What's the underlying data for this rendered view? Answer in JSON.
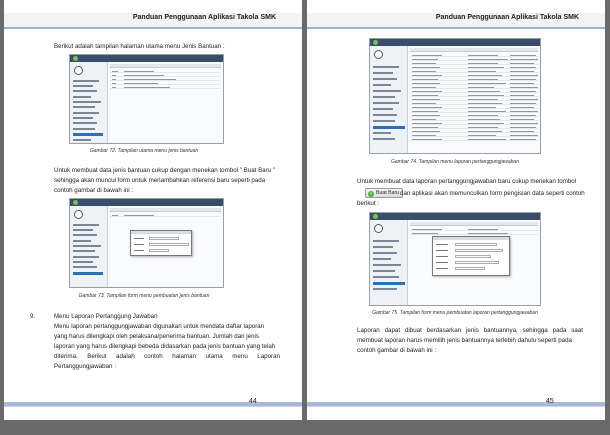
{
  "header_title": "Panduan Penggunaan Aplikasi Takola SMK",
  "left": {
    "page_number": "44",
    "para1": "Berikut adalah tampilan halaman utama menu Jenis Bantuan :",
    "caption1": "Gambar 72. Tampilan utama menu jenis bantuan",
    "para2_l1": "Untuk membuat data jenis bantuan cukup dengan menekan tombol \" Buat Baru \"",
    "para2_l2": "sehingga akan muncul form untuk menambahkan referensi baru seperti pada",
    "para2_l3": "contoh gambar di bawah ini :",
    "caption2": "Gambar 73. Tampilan form menu pembuatan jenis bantuan",
    "section_number": "9.",
    "section_title": "Menu Laporan Pertanggung Jawaban",
    "para3_l1": "Menu laporan pertanggungjawaban digunakan untuk mendata daftar laporan",
    "para3_l2": "yang harus dilengkapi oleh pelaksana/penerima bantuan. Jumlah dan jenis",
    "para3_l3": "laporan yang harus dilengkapi bebeda didasarkan pada jenis bantuan yang telah",
    "para3_l4": "diterima. Berikut adalah contoh halaman utama menu Laporan",
    "para3_l5": "Pertanggungjawaban :"
  },
  "right": {
    "page_number": "45",
    "caption1": "Gambar 74. Tampilan menu laporan pertanggungjawaban",
    "para1_l1": "Untuk membuat data laporan pertanggungjawaban baru cukup menekan tombol",
    "button_label": "Buat Baru",
    "para1_l2": "dan aplikasi akan memunculkan form pengisian data seperti contoh",
    "para1_l3": "berikut :",
    "caption2": "Gambar 75. Tampilan form menu pembuatan laporan pertanggungjawaban",
    "para2_l1": "Laporan dapat dibuat berdasarkan jenis bantuannya, sehingga pada saat",
    "para2_l2": "membuat laporan harus memilih jenis bantuannya terlebih dahulu seperti pada",
    "para2_l3": "contoh gambar di bawah ini :"
  },
  "icons": {
    "button_plus": "plus-circle-icon"
  },
  "colors": {
    "header_rule": "#9fb1d6",
    "footer_bar": "#aab8d8",
    "app_toolbar": "#3a4e6c",
    "button_icon": "#55a93b"
  }
}
